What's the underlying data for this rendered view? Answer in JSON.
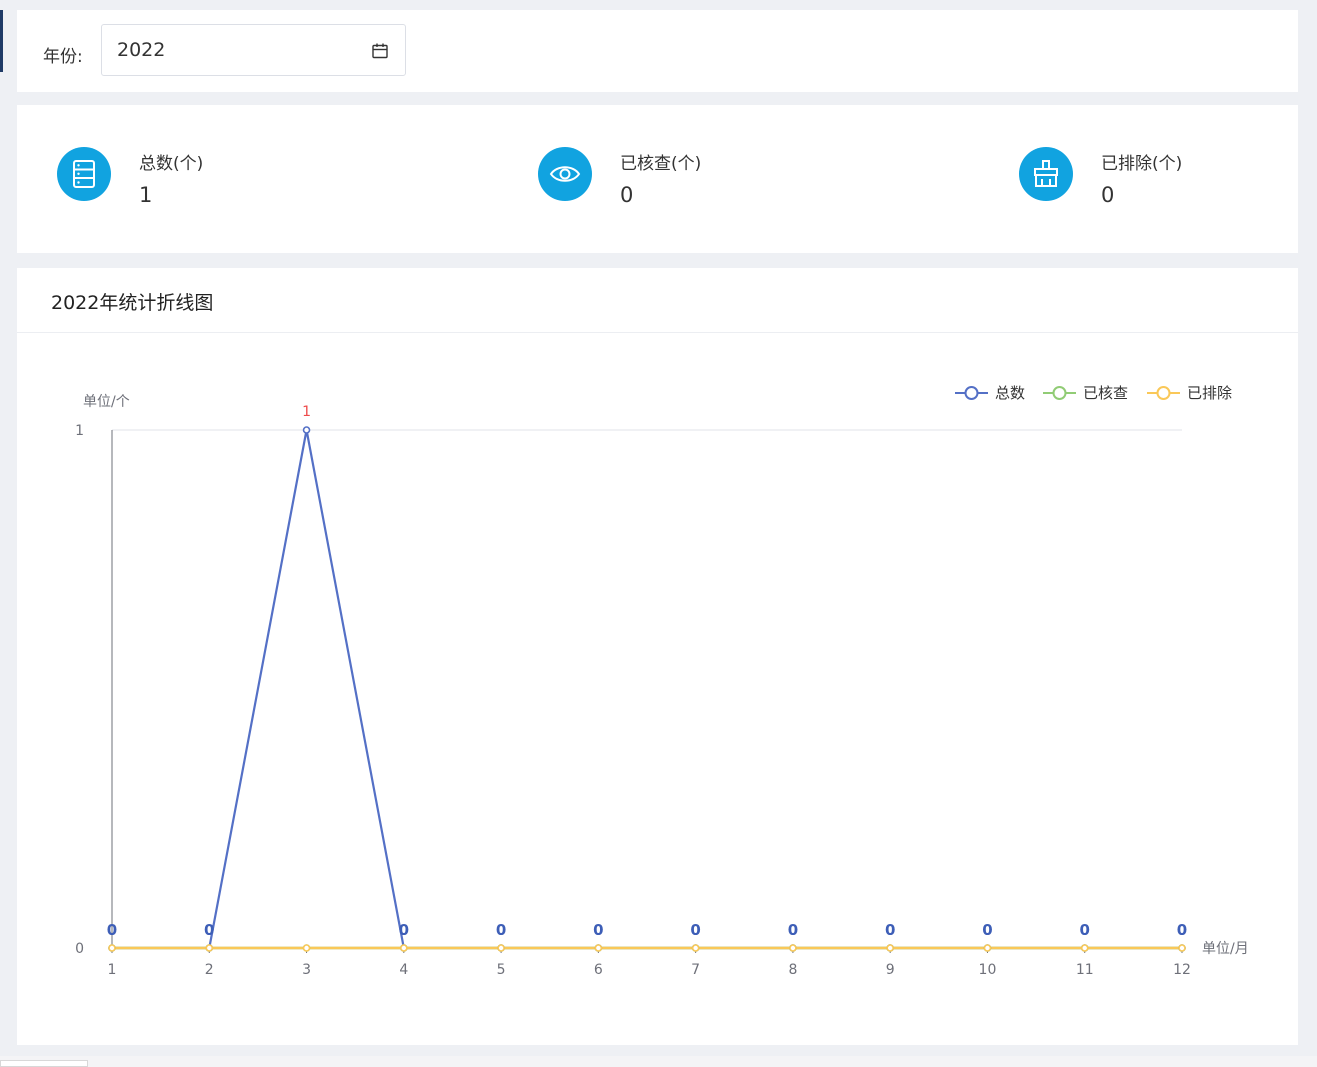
{
  "filter": {
    "year_label": "年份:",
    "year_value": "2022"
  },
  "stats": [
    {
      "label": "总数(个)",
      "value": "1",
      "icon": "list-icon"
    },
    {
      "label": "已核查(个)",
      "value": "0",
      "icon": "eye-icon"
    },
    {
      "label": "已排除(个)",
      "value": "0",
      "icon": "broom-icon"
    }
  ],
  "chart_panel": {
    "title": "2022年统计折线图"
  },
  "colors": {
    "accent": "#11a3e0",
    "series_total": "#5470c6",
    "series_checked": "#91cc75",
    "series_excluded": "#fac858",
    "highlight_label": "#ee4b4b"
  },
  "chart_data": {
    "type": "line",
    "title": "2022年统计折线图",
    "xlabel": "单位/月",
    "ylabel": "单位/个",
    "x": [
      "1",
      "2",
      "3",
      "4",
      "5",
      "6",
      "7",
      "8",
      "9",
      "10",
      "11",
      "12"
    ],
    "ylim": [
      0,
      1
    ],
    "yticks": [
      "0",
      "1"
    ],
    "grid": true,
    "legend_position": "top-right",
    "series": [
      {
        "name": "总数",
        "values": [
          0,
          0,
          1,
          0,
          0,
          0,
          0,
          0,
          0,
          0,
          0,
          0
        ]
      },
      {
        "name": "已核查",
        "values": [
          0,
          0,
          0,
          0,
          0,
          0,
          0,
          0,
          0,
          0,
          0,
          0
        ]
      },
      {
        "name": "已排除",
        "values": [
          0,
          0,
          0,
          0,
          0,
          0,
          0,
          0,
          0,
          0,
          0,
          0
        ]
      }
    ]
  }
}
